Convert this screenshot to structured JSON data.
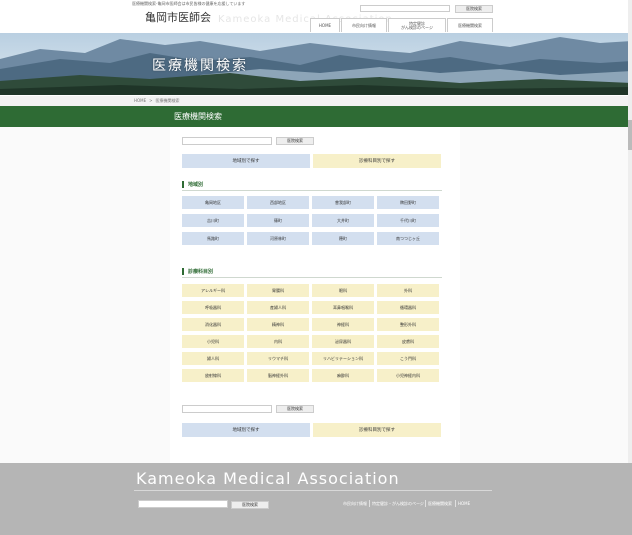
{
  "header": {
    "tagline": "医療機関検索-亀岡市医師会は市民皆様の健康を応援しています",
    "site_title": "亀岡市医師会",
    "site_title_en": "Kameoka Medical Association",
    "search_button": "医院検索",
    "nav": [
      "HOME",
      "市民向け情報",
      "特定健診\nがん検診のページ",
      "医療機関検索"
    ]
  },
  "banner": {
    "title": "医療機関検索"
  },
  "breadcrumb": {
    "home": "HOME",
    "separator": ">",
    "current": "医療機関検索"
  },
  "page_title": "医療機関検索",
  "search": {
    "button": "医院検索",
    "placeholder": ""
  },
  "tabs": {
    "region": "地域別で探す",
    "department": "診療科目別で探す"
  },
  "region_section": {
    "heading": "地域別",
    "items": [
      "亀岡地区",
      "西部地区",
      "曽我部町",
      "稗田野町",
      "吉川町",
      "篠町",
      "大井町",
      "千代川町",
      "馬路町",
      "河原林町",
      "穂町",
      "南つつじヶ丘"
    ]
  },
  "department_section": {
    "heading": "診療科目別",
    "items": [
      "アレルギー科",
      "胃腸科",
      "眼科",
      "外科",
      "呼吸器科",
      "産婦人科",
      "耳鼻咽喉科",
      "循環器科",
      "消化器科",
      "精神科",
      "神経科",
      "整形外科",
      "小児科",
      "内科",
      "泌尿器科",
      "皮膚科",
      "婦人科",
      "リウマチ科",
      "リハビリテーション科",
      "こう門科",
      "放射線科",
      "脳神経外科",
      "麻酔科",
      "小児神経内科"
    ]
  },
  "footer": {
    "brand": "Kameoka Medical Association",
    "search_button": "医院検索",
    "links": [
      "市民向け情報",
      "特定健診・がん検診のページ",
      "医療機関検索",
      "HOME"
    ]
  },
  "colors": {
    "accent_green": "#2e6b34",
    "region_cell": "#d3dfef",
    "department_cell": "#f7f0c9",
    "footer_bg": "#b5b5b5"
  }
}
